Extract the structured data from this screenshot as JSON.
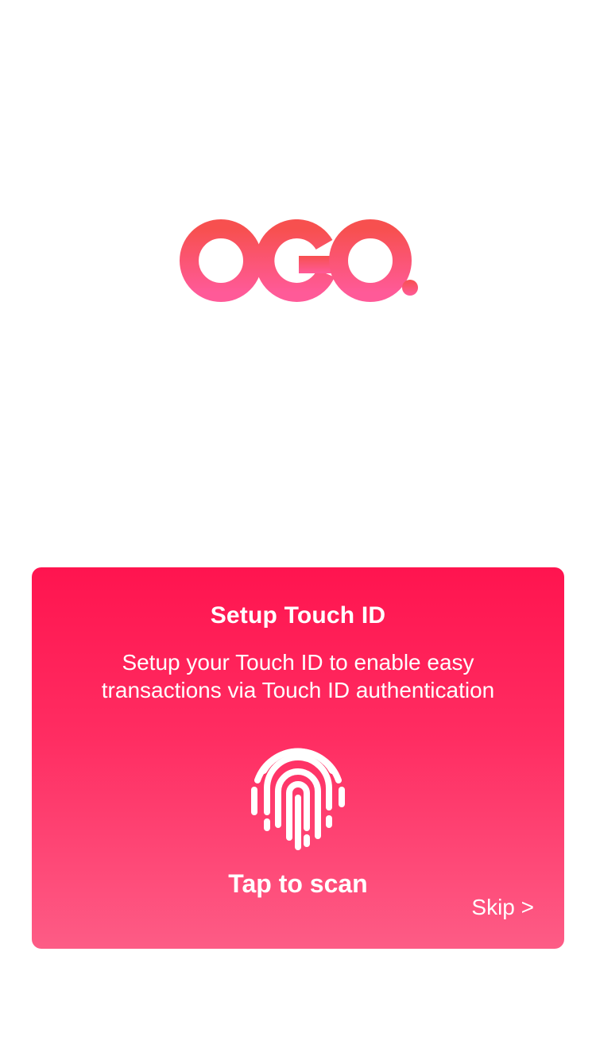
{
  "app": {
    "logo_text": "OGO",
    "brand_color": "#ff1f55",
    "logo_gradient": [
      "#f74a5d",
      "#ff5c93"
    ]
  },
  "touch_id_card": {
    "title": "Setup Touch ID",
    "description_lines": [
      "Setup your Touch ID to enable easy",
      "transactions via Touch ID authentication"
    ],
    "icon": "fingerprint-icon",
    "action_label": "Tap to scan",
    "skip_label": "Skip >",
    "gradient": [
      "#ff144f",
      "#fd5c86"
    ]
  }
}
